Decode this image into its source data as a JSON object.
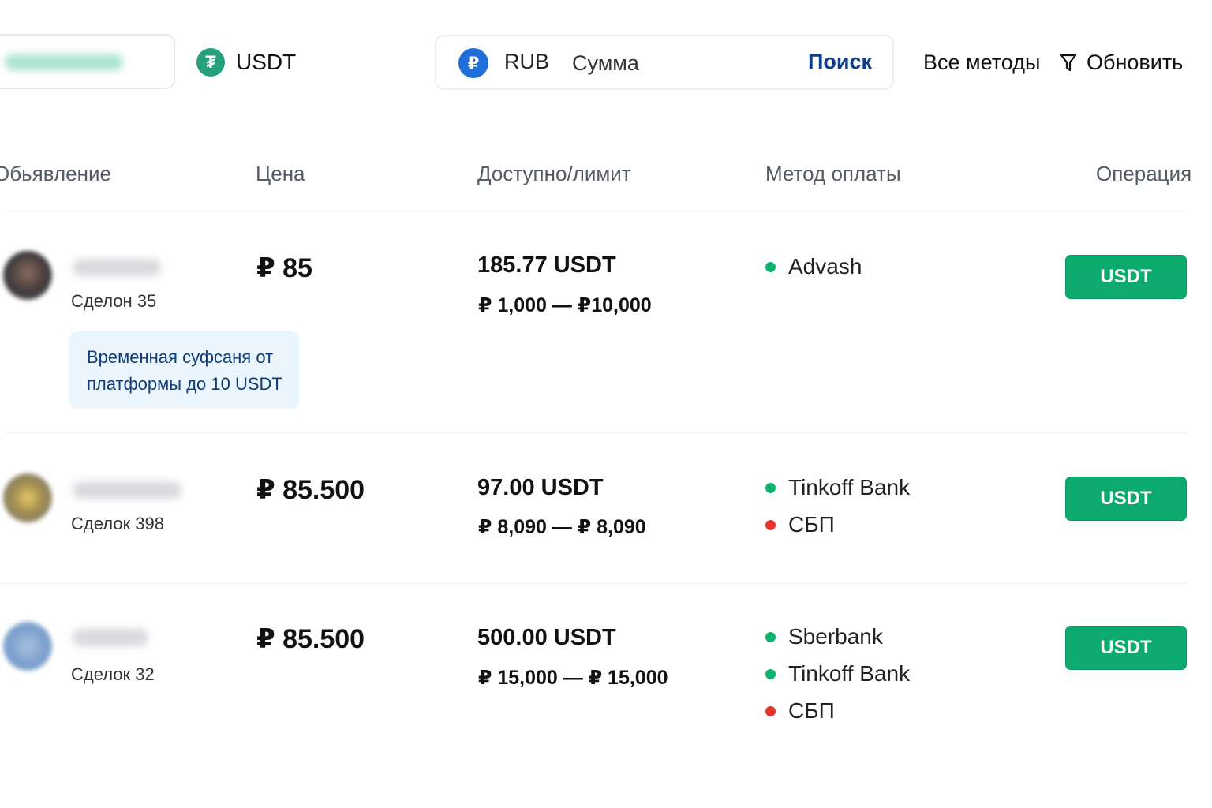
{
  "colors": {
    "accent_green": "#0daa6e",
    "search_blue": "#0d3d8c",
    "dot_green": "#0db36f",
    "dot_red": "#e8352b",
    "promo_bg": "#eaf5fd"
  },
  "topbar": {
    "crypto": {
      "icon": "tether-icon",
      "label": "USDT"
    },
    "fiat": {
      "icon": "ruble-icon",
      "label": "RUB"
    },
    "amount_placeholder": "Сумма",
    "search_label": "Поиск",
    "all_methods_label": "Все методы",
    "refresh_label": "Обновить",
    "filter_icon": "filter-icon"
  },
  "table": {
    "headers": {
      "ad": "Обьявление",
      "price": "Цена",
      "available": "Доступно/лимит",
      "payment": "Метод оплаты",
      "operation": "Операция"
    },
    "rows": [
      {
        "deals": "Сделон 35",
        "price": "₽ 85",
        "available": "185.77 USDT",
        "limit": "₽ 1,000 — ₽10,000",
        "methods": [
          {
            "name": "Advash",
            "status": "green"
          }
        ],
        "button": "USDT",
        "promo": {
          "line1": "Временная суфсаня от",
          "line2": "платформы до 10 USDT"
        }
      },
      {
        "deals": "Сделок 398",
        "price": "₽ 85.500",
        "available": "97.00 USDT",
        "limit": "₽ 8,090 — ₽ 8,090",
        "methods": [
          {
            "name": "Tinkoff Bank",
            "status": "green"
          },
          {
            "name": "СБП",
            "status": "red"
          }
        ],
        "button": "USDT"
      },
      {
        "deals": "Сделок 32",
        "price": "₽ 85.500",
        "available": "500.00 USDT",
        "limit": "₽ 15,000 — ₽ 15,000",
        "methods": [
          {
            "name": "Sberbank",
            "status": "green"
          },
          {
            "name": "Tinkoff Bank",
            "status": "green"
          },
          {
            "name": "СБП",
            "status": "red"
          }
        ],
        "button": "USDT"
      }
    ]
  }
}
